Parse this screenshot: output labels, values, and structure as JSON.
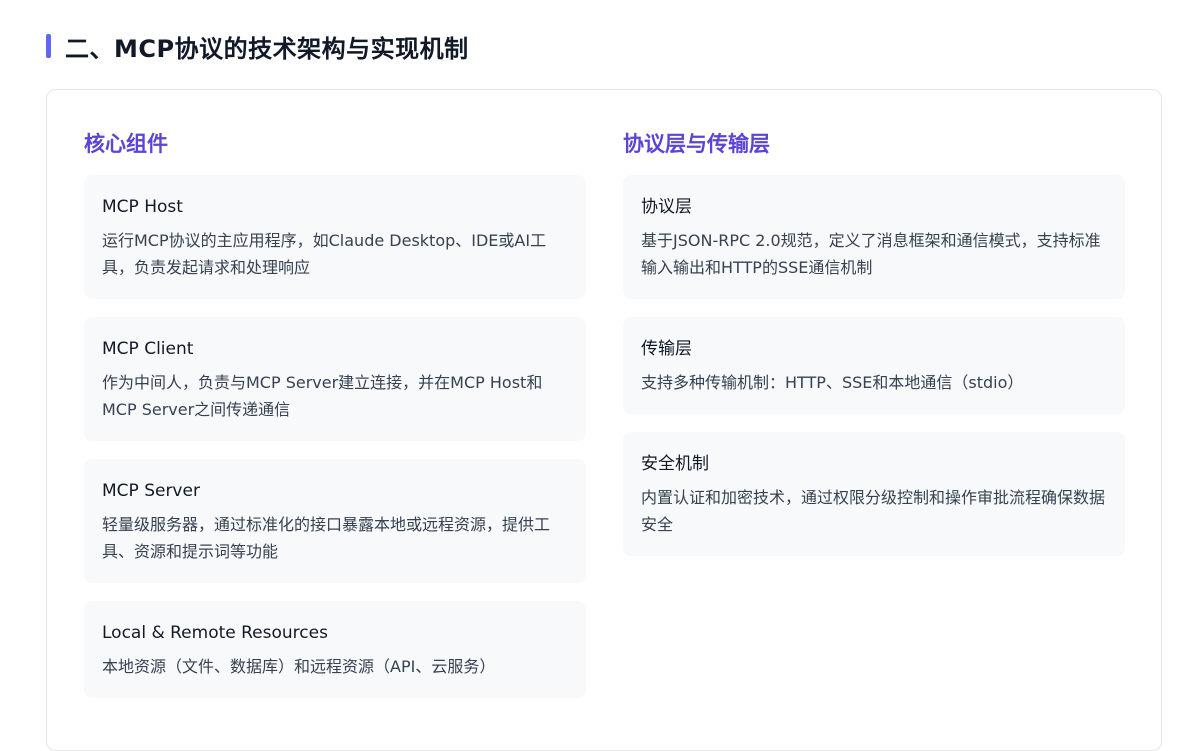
{
  "section": {
    "title": "二、MCP协议的技术架构与实现机制"
  },
  "left": {
    "heading": "核心组件",
    "items": [
      {
        "title": "MCP Host",
        "desc": "运行MCP协议的主应用程序，如Claude Desktop、IDE或AI工具，负责发起请求和处理响应"
      },
      {
        "title": "MCP Client",
        "desc": "作为中间人，负责与MCP Server建立连接，并在MCP Host和MCP Server之间传递通信"
      },
      {
        "title": "MCP Server",
        "desc": "轻量级服务器，通过标准化的接口暴露本地或远程资源，提供工具、资源和提示词等功能"
      },
      {
        "title": "Local & Remote Resources",
        "desc": "本地资源（文件、数据库）和远程资源（API、云服务）"
      }
    ]
  },
  "right": {
    "heading": "协议层与传输层",
    "items": [
      {
        "title": "协议层",
        "desc": "基于JSON-RPC 2.0规范，定义了消息框架和通信模式，支持标准输入输出和HTTP的SSE通信机制"
      },
      {
        "title": "传输层",
        "desc": "支持多种传输机制：HTTP、SSE和本地通信（stdio）"
      },
      {
        "title": "安全机制",
        "desc": "内置认证和加密技术，通过权限分级控制和操作审批流程确保数据安全"
      }
    ]
  },
  "colors": {
    "accent": "#6366f1",
    "heading": "#5b45d6",
    "item_bg": "#f8f9fb"
  }
}
